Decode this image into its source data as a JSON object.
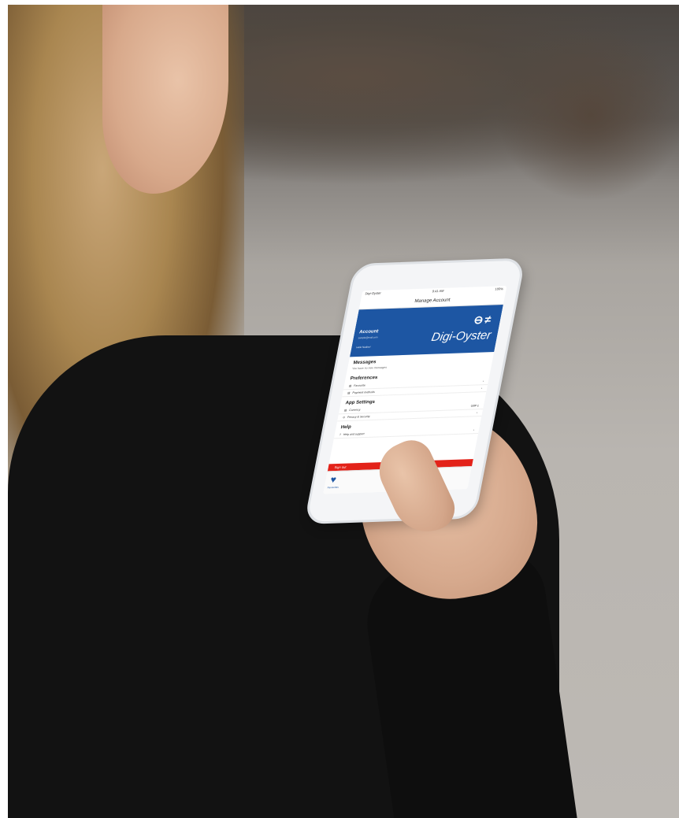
{
  "screen": {
    "status_left": "Digi-Oyster",
    "status_time": "9:41 AM",
    "status_battery": "100%",
    "nav_title": "Manage Account",
    "account": {
      "label": "Account",
      "line1": "sample@mail.com",
      "line2": "Hello Nadine!",
      "brand": "Digi-Oyster",
      "logo_icon": "underground-rail-icons"
    },
    "messages": {
      "title": "Messages",
      "note": "You have no new messages"
    },
    "preferences": {
      "title": "Preferences",
      "items": [
        {
          "label": "Favourite",
          "value": ""
        },
        {
          "label": "Payment methods",
          "value": ""
        }
      ]
    },
    "app_settings": {
      "title": "App Settings",
      "items": [
        {
          "label": "Currency",
          "value": "GBP £"
        },
        {
          "label": "Privacy & Security",
          "value": ""
        }
      ]
    },
    "help": {
      "title": "Help",
      "items": [
        {
          "label": "Help and support",
          "value": ""
        }
      ]
    },
    "signout_label": "Sign out",
    "tabbar": {
      "favourites_label": "Favourites"
    },
    "colors": {
      "brand_blue": "#1d56a3",
      "signout_red": "#e32219"
    }
  }
}
